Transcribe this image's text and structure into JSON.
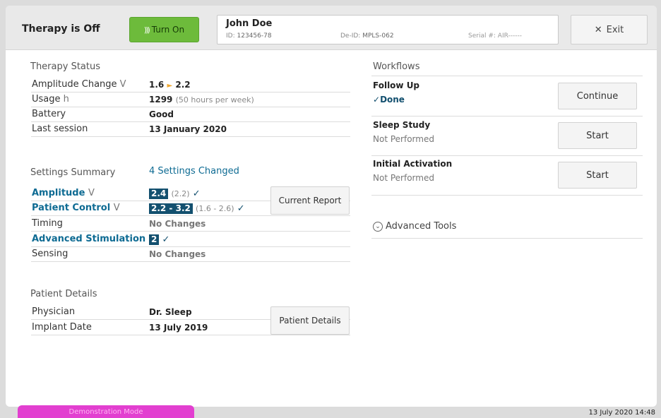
{
  "header": {
    "therapy_status": "Therapy is Off",
    "turn_on_label": "Turn On",
    "patient_name": "John Doe",
    "patient_id_label": "ID:",
    "patient_id": "123456-78",
    "deid_label": "De-ID:",
    "deid": "MPLS-062",
    "serial_label": "Serial #:",
    "serial": "AIR------",
    "exit_label": "Exit"
  },
  "therapy_status": {
    "title": "Therapy Status",
    "rows": [
      {
        "label": "Amplitude Change",
        "unit": "V",
        "from": "1.6",
        "to": "2.2"
      },
      {
        "label": "Usage",
        "unit": "h",
        "value": "1299",
        "note": "(50 hours per week)"
      },
      {
        "label": "Battery",
        "value": "Good"
      },
      {
        "label": "Last session",
        "value": "13 January 2020"
      }
    ]
  },
  "settings_summary": {
    "title": "Settings Summary",
    "changed": "4  Settings Changed",
    "current_report_label": "Current Report",
    "rows": [
      {
        "label": "Amplitude",
        "unit": "V",
        "value": "2.4",
        "previous": "(2.2)"
      },
      {
        "label": "Patient Control",
        "unit": "V",
        "value": "2.2 - 3.2",
        "previous": "(1.6 - 2.6)"
      },
      {
        "label": "Timing",
        "value": "No Changes"
      },
      {
        "label": "Advanced Stimulation",
        "value": "2"
      },
      {
        "label": "Sensing",
        "value": "No Changes"
      }
    ]
  },
  "patient_details": {
    "title": "Patient Details",
    "button_label": "Patient Details",
    "rows": [
      {
        "label": "Physician",
        "value": "Dr. Sleep"
      },
      {
        "label": "Implant Date",
        "value": "13 July 2019"
      }
    ]
  },
  "workflows": {
    "title": "Workflows",
    "items": [
      {
        "name": "Follow Up",
        "status": "Done",
        "button": "Continue"
      },
      {
        "name": "Sleep Study",
        "status": "Not Performed",
        "button": "Start"
      },
      {
        "name": "Initial Activation",
        "status": "Not Performed",
        "button": "Start"
      }
    ],
    "advanced_tools": "Advanced Tools"
  },
  "footer": {
    "demo_mode": "Demonstration Mode",
    "datetime": "13 July 2020 14:48"
  },
  "colors": {
    "accent_green": "#6dbb3b",
    "accent_blue": "#13506f",
    "demo_magenta": "#e23fd0"
  }
}
